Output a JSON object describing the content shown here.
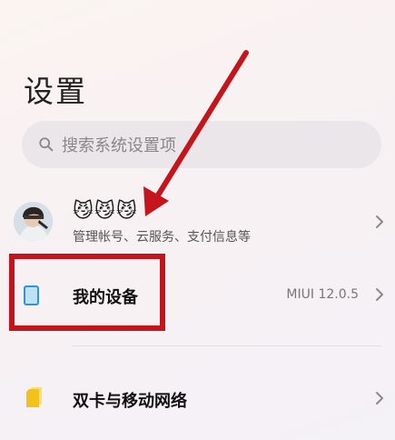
{
  "header": {
    "title": "设置"
  },
  "search": {
    "placeholder": "搜索系统设置项",
    "icon": "search-icon"
  },
  "account": {
    "name": "😼😼😼",
    "subtitle": "管理帐号、云服务、支付信息等",
    "avatar_icon": "avatar"
  },
  "settings_items": [
    {
      "label": "我的设备",
      "value": "MIUI 12.0.5",
      "icon": "device-icon"
    },
    {
      "label": "双卡与移动网络",
      "icon": "sim-card-icon"
    }
  ],
  "annotation": {
    "color": "#c4151c"
  },
  "colors": {
    "accent_blue": "#2e93d8",
    "sim_yellow": "#f2c21a",
    "highlight_red": "#c4151c"
  }
}
